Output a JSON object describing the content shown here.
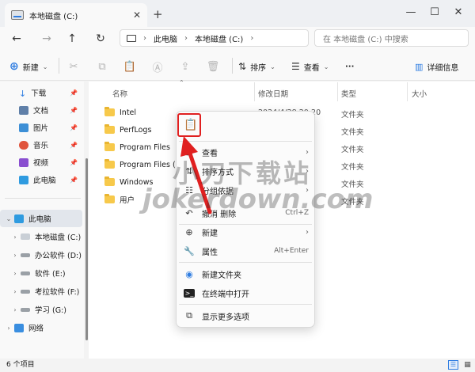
{
  "window": {
    "tab_title": "本地磁盘 (C:)",
    "new_tab": "+",
    "close_tab": "✕"
  },
  "nav": {
    "breadcrumb": [
      "此电脑",
      "本地磁盘 (C:)"
    ],
    "search_placeholder": "在 本地磁盘 (C:) 中搜索"
  },
  "toolbar": {
    "new_label": "新建",
    "sort_label": "排序",
    "view_label": "查看",
    "more_label": "···",
    "details_label": "详细信息"
  },
  "sidebar": {
    "quick_access": [
      {
        "label": "下载",
        "pinned": true
      },
      {
        "label": "文档",
        "pinned": true
      },
      {
        "label": "图片",
        "pinned": true
      },
      {
        "label": "音乐",
        "pinned": true
      },
      {
        "label": "视频",
        "pinned": true
      },
      {
        "label": "此电脑",
        "pinned": true
      }
    ],
    "this_pc": "此电脑",
    "drives": [
      {
        "label": "本地磁盘 (C:)"
      },
      {
        "label": "办公软件 (D:)"
      },
      {
        "label": "软件 (E:)"
      },
      {
        "label": "考拉软件 (F:)"
      },
      {
        "label": "学习 (G:)"
      }
    ],
    "network": "网络"
  },
  "columns": {
    "name": "名称",
    "modified": "修改日期",
    "type": "类型",
    "size": "大小"
  },
  "files": [
    {
      "name": "Intel",
      "modified": "2024/4/28 20:20",
      "type": "文件夹"
    },
    {
      "name": "PerfLogs",
      "type": "文件夹"
    },
    {
      "name": "Program Files",
      "type": "文件夹"
    },
    {
      "name": "Program Files (x86)",
      "type": "文件夹"
    },
    {
      "name": "Windows",
      "type": "文件夹"
    },
    {
      "name": "用户",
      "type": "文件夹"
    }
  ],
  "context_menu": {
    "items": [
      {
        "label": "查看",
        "arrow": "›"
      },
      {
        "label": "排序方式",
        "arrow": "›"
      },
      {
        "label": "分组依据",
        "arrow": "›"
      },
      {
        "label": "撤消 删除",
        "shortcut": "Ctrl+Z"
      },
      {
        "label": "新建",
        "arrow": "›"
      },
      {
        "label": "属性",
        "shortcut": "Alt+Enter"
      },
      {
        "label": "新建文件夹"
      },
      {
        "label": "在终端中打开"
      },
      {
        "label": "显示更多选项"
      }
    ]
  },
  "watermark": {
    "line1": "小刀下载站",
    "line2": "jokerdown.com"
  },
  "status": {
    "item_count": "6 个项目"
  },
  "colors": {
    "highlight_red": "#e02020",
    "folder_yellow": "#f7c94b",
    "accent_blue": "#2f7de1"
  }
}
